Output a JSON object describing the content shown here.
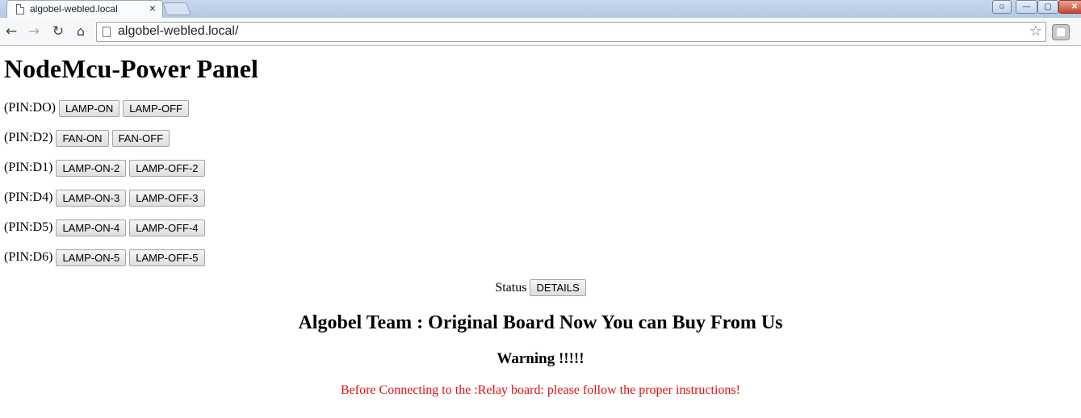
{
  "browser": {
    "tab_title": "algobel-webled.local",
    "tab_close_glyph": "×",
    "url": "algobel-webled.local/",
    "nav_back_glyph": "←",
    "nav_forward_glyph": "→",
    "nav_reload_glyph": "↻",
    "nav_home_glyph": "⌂",
    "bookmark_star_glyph": "☆",
    "window_buttons": {
      "minimize": "—",
      "maximize": "▢",
      "close": "✕"
    }
  },
  "page": {
    "title": "NodeMcu-Power Panel",
    "pins": [
      {
        "label": "(PIN:DO)",
        "on": "LAMP-ON",
        "off": "LAMP-OFF"
      },
      {
        "label": "(PIN:D2)",
        "on": "FAN-ON",
        "off": "FAN-OFF"
      },
      {
        "label": "(PIN:D1)",
        "on": "LAMP-ON-2",
        "off": "LAMP-OFF-2"
      },
      {
        "label": "(PIN:D4)",
        "on": "LAMP-ON-3",
        "off": "LAMP-OFF-3"
      },
      {
        "label": "(PIN:D5)",
        "on": "LAMP-ON-4",
        "off": "LAMP-OFF-4"
      },
      {
        "label": "(PIN:D6)",
        "on": "LAMP-ON-5",
        "off": "LAMP-OFF-5"
      }
    ],
    "status_label": "Status",
    "details_button": "DETAILS",
    "team_heading": "Algobel Team : Original Board Now You can Buy From Us",
    "warning_heading": "Warning !!!!!",
    "warning_text": "Before Connecting to the :Relay board: please follow the proper instructions!",
    "colors": {
      "warning_text": "#e01010",
      "titlebar": "#c9d9ee",
      "close_button": "#c8452f"
    }
  }
}
